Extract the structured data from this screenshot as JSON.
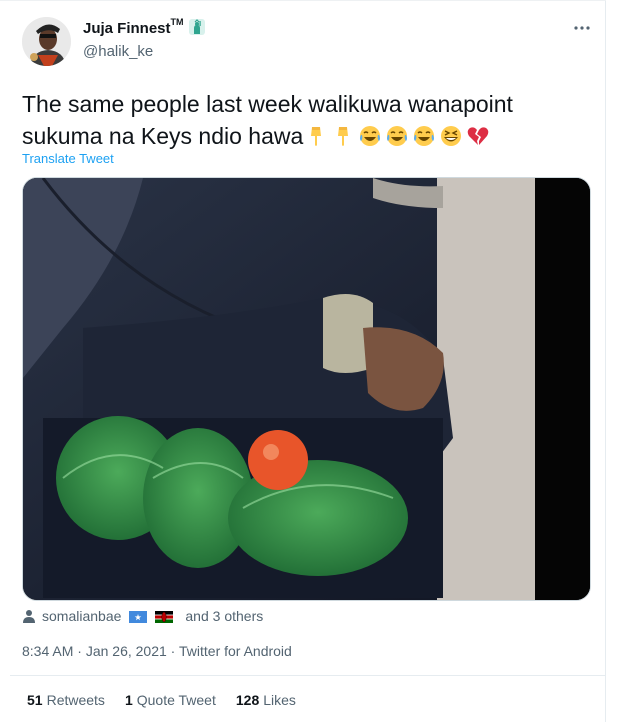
{
  "author": {
    "name": "Juja Finnest",
    "trademark": "TM",
    "handle": "@halik_ke"
  },
  "tweet": {
    "text": "The same people last week walikuwa wanapoint sukuma na Keys ndio hawa",
    "emojis": [
      "backhand-index-pointing-down",
      "backhand-index-pointing-down",
      "face-with-tears-of-joy",
      "face-with-tears-of-joy",
      "face-with-tears-of-joy",
      "grinning-squinting-face",
      "broken-heart"
    ],
    "translate_label": "Translate Tweet"
  },
  "tagged": {
    "user": "somalianbae",
    "flags": [
      "somalia-flag",
      "kenya-flag"
    ],
    "others": "and 3 others"
  },
  "meta": {
    "time": "8:34 AM",
    "date": "Jan 26, 2021",
    "separator": " · ",
    "source": "Twitter for Android"
  },
  "stats": {
    "retweets_count": "51",
    "retweets_label": "Retweets",
    "quotes_count": "1",
    "quotes_label": "Quote Tweet",
    "likes_count": "128",
    "likes_label": "Likes"
  },
  "colors": {
    "link": "#1da1f2",
    "muted": "#536471",
    "text": "#0f1419"
  }
}
